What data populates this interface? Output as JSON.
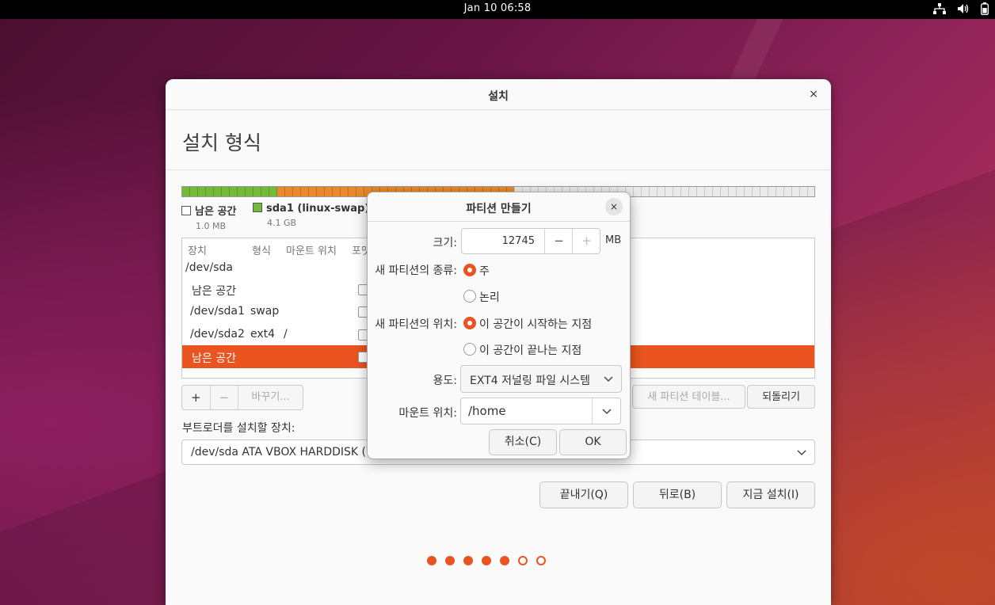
{
  "topbar": {
    "clock": "Jan 10  06:58"
  },
  "window": {
    "title": "설치",
    "close": "×",
    "heading": "설치 형식"
  },
  "legend": [
    {
      "name": "남은 공간",
      "size": "1.0 MB",
      "color": "#ffffff"
    },
    {
      "name": "sda1 (linux-swap)",
      "size": "4.1 GB",
      "color": "#75b93a"
    }
  ],
  "colors": {
    "accent": "#e95420",
    "swap": "#75b93a",
    "ext4": "#e7892c"
  },
  "table": {
    "headers": [
      "장치",
      "형식",
      "마운트 위치",
      "포맷"
    ],
    "rows": [
      {
        "device": "/dev/sda",
        "type": "",
        "mount": ""
      },
      {
        "device": "남은 공간",
        "type": "",
        "mount": ""
      },
      {
        "device": "/dev/sda1",
        "type": "swap",
        "mount": ""
      },
      {
        "device": "/dev/sda2",
        "type": "ext4",
        "mount": "/"
      },
      {
        "device": "남은 공간",
        "type": "",
        "mount": ""
      }
    ]
  },
  "tools": {
    "add": "+",
    "remove": "−",
    "change": "바꾸기...",
    "new_table": "새 파티션 테이블...",
    "revert": "되돌리기"
  },
  "bootloader": {
    "label": "부트로더를 설치할 장치:",
    "value": "/dev/sda   ATA VBOX HARDDISK ("
  },
  "actions": {
    "quit": "끝내기(Q)",
    "back": "뒤로(B)",
    "install": "지금 설치(I)"
  },
  "progress": {
    "total": 7,
    "current": 5
  },
  "dialog": {
    "title": "파티션 만들기",
    "close": "×",
    "size_label": "크기:",
    "size_value": "12745",
    "size_unit": "MB",
    "minus": "−",
    "plus": "+",
    "type_label": "새 파티션의 종류:",
    "type_primary": "주",
    "type_logical": "논리",
    "location_label": "새 파티션의 위치:",
    "location_start": "이 공간이 시작하는 지점",
    "location_end": "이 공간이 끝나는 지점",
    "use_label": "용도:",
    "use_value": "EXT4 저널링 파일 시스템",
    "mount_label": "마운트 위치:",
    "mount_value": "/home",
    "cancel": "취소(C)",
    "ok": "OK"
  }
}
